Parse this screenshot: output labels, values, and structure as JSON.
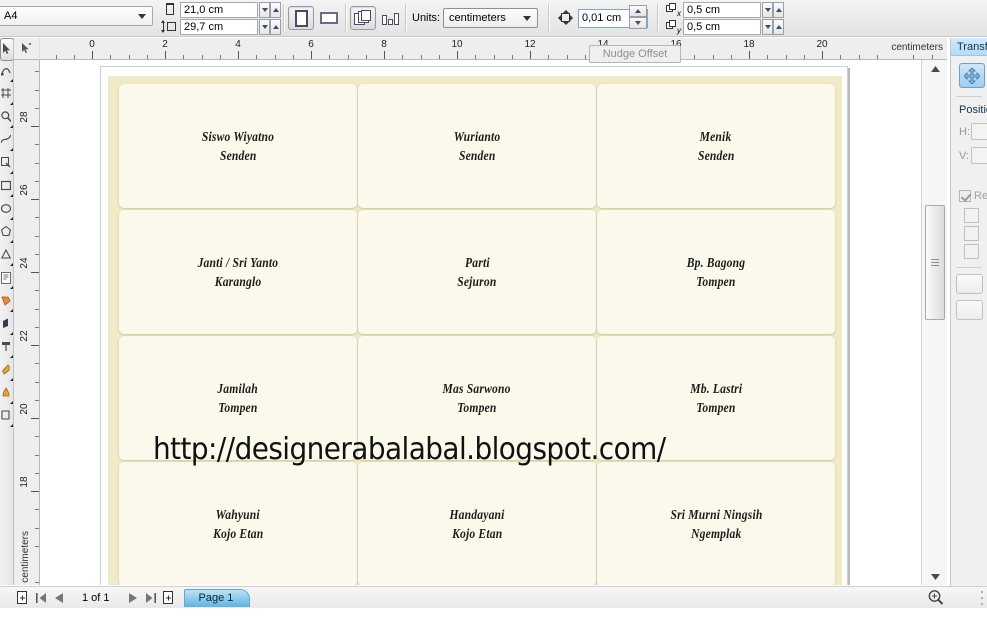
{
  "propbar": {
    "page_size": "A4",
    "width_value": "21,0 cm",
    "height_value": "29,7 cm",
    "units_label": "Units:",
    "units_value": "centimeters",
    "nudge_offset": "0,01 cm",
    "duplicate_x": "0,5 cm",
    "duplicate_y": "0,5 cm",
    "icons": {
      "page_width": "page-width-icon",
      "page_height": "page-height-icon",
      "portrait": "portrait-orientation-icon",
      "landscape": "landscape-orientation-icon",
      "all_pages": "apply-to-all-pages-icon",
      "current_page": "apply-to-current-page-icon",
      "nudge": "nudge-offset-icon",
      "dup_x": "duplicate-distance-x-icon",
      "dup_y": "duplicate-distance-y-icon"
    }
  },
  "tooltip": {
    "text": "Nudge Offset"
  },
  "rulers": {
    "horizontal": {
      "labels": [
        "0",
        "2",
        "4",
        "6",
        "8",
        "10",
        "12",
        "14",
        "16",
        "18",
        "20"
      ],
      "units": "centimeters"
    },
    "vertical": {
      "labels": [
        "28",
        "26",
        "24",
        "22",
        "20",
        "18"
      ],
      "units": "centimeters"
    }
  },
  "toolbox": {
    "tools": [
      "pick-tool",
      "shape-tool",
      "crop-tool",
      "zoom-tool",
      "freehand-tool",
      "smart-fill-tool",
      "rectangle-tool",
      "ellipse-tool",
      "polygon-tool",
      "basic-shapes-tool",
      "text-tool",
      "table-tool",
      "blend-tool",
      "color-eyedropper-tool",
      "outline-tool",
      "fill-tool",
      "interactive-fill-tool"
    ]
  },
  "document": {
    "watermark": "http://designerabalabal.blogspot.com/",
    "cards": [
      {
        "name": "Siswo Wiyatno",
        "place": "Senden"
      },
      {
        "name": "Wurianto",
        "place": "Senden"
      },
      {
        "name": "Menik",
        "place": "Senden"
      },
      {
        "name": "Janti / Sri Yanto",
        "place": "Karanglo"
      },
      {
        "name": "Parti",
        "place": "Sejuron"
      },
      {
        "name": "Bp. Bagong",
        "place": "Tompen"
      },
      {
        "name": "Jamilah",
        "place": "Tompen"
      },
      {
        "name": "Mas Sarwono",
        "place": "Tompen"
      },
      {
        "name": "Mb. Lastri",
        "place": "Tompen"
      },
      {
        "name": "Wahyuni",
        "place": "Kojo Etan"
      },
      {
        "name": "Handayani",
        "place": "Kojo Etan"
      },
      {
        "name": "Sri Murni Ningsih",
        "place": "Ngemplak"
      }
    ]
  },
  "statusbar": {
    "page_count": "1 of 1",
    "page_tab": "Page 1",
    "buttons": {
      "add_page_start": "add-page-before-icon",
      "first_page": "first-page-icon",
      "prev_page": "previous-page-icon",
      "next_page": "next-page-icon",
      "last_page": "last-page-icon",
      "add_page_end": "add-page-after-icon",
      "zoom": "zoom-magnifier-icon"
    }
  },
  "docker": {
    "title": "Transform",
    "mode_icon": "move-position-icon",
    "section_title": "Position",
    "field_h_label": "H:",
    "field_v_label": "V:",
    "relative_label": "Relative Position",
    "relative_checked": true
  },
  "colors": {
    "page_background": "#f0eac6",
    "card_fill": "#fbf8ec",
    "accent_blue": "#5ab4e4",
    "toolbar_bg": "#ebebeb"
  }
}
